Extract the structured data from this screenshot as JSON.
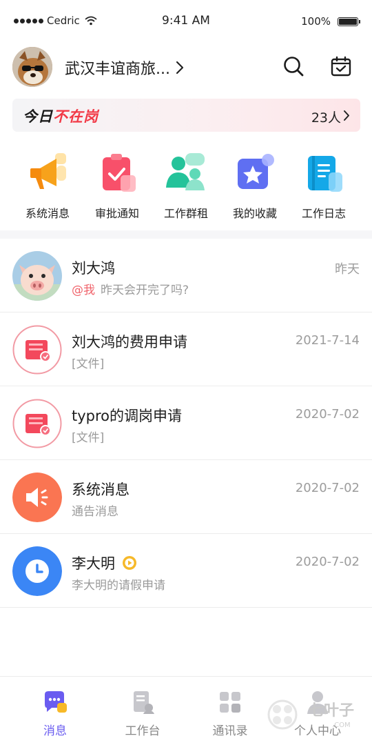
{
  "status_bar": {
    "carrier": "Cedric",
    "time": "9:41 AM",
    "battery": "100%"
  },
  "header": {
    "company": "武汉丰谊商旅..."
  },
  "banner": {
    "title_part1": "今日",
    "title_part2": "不在岗",
    "count": "23人"
  },
  "quick_actions": [
    {
      "label": "系统消息",
      "icon": "megaphone-icon"
    },
    {
      "label": "审批通知",
      "icon": "approval-clipboard-icon"
    },
    {
      "label": "工作群租",
      "icon": "group-chat-icon"
    },
    {
      "label": "我的收藏",
      "icon": "favorites-star-icon"
    },
    {
      "label": "工作日志",
      "icon": "worklog-notebook-icon"
    }
  ],
  "messages": [
    {
      "name": "刘大鸿",
      "at": "@我",
      "preview": "昨天会开完了吗?",
      "time": "昨天",
      "avatar": "pig-photo-avatar"
    },
    {
      "name": "刘大鸿的费用申请",
      "preview": "[文件]",
      "time": "2021-7-14",
      "avatar": "document-approval-icon"
    },
    {
      "name": "typro的调岗申请",
      "preview": "[文件]",
      "time": "2020-7-02",
      "avatar": "document-approval-icon"
    },
    {
      "name": "系统消息",
      "preview": "通告消息",
      "time": "2020-7-02",
      "avatar": "speaker-icon"
    },
    {
      "name": "李大明",
      "preview": "李大明的请假申请",
      "time": "2020-7-02",
      "avatar": "clock-icon"
    }
  ],
  "tabbar": [
    {
      "label": "消息",
      "active": true
    },
    {
      "label": "工作台",
      "active": false
    },
    {
      "label": "通讯录",
      "active": false
    },
    {
      "label": "个人中心",
      "active": false
    }
  ],
  "watermark": {
    "text": "七叶子",
    "sub": ".COM"
  },
  "colors": {
    "accent": "#6a5cf0",
    "alert_red": "#f23a47",
    "mention": "#f0646c",
    "orange": "#fa7552",
    "blue": "#3b86f5"
  }
}
